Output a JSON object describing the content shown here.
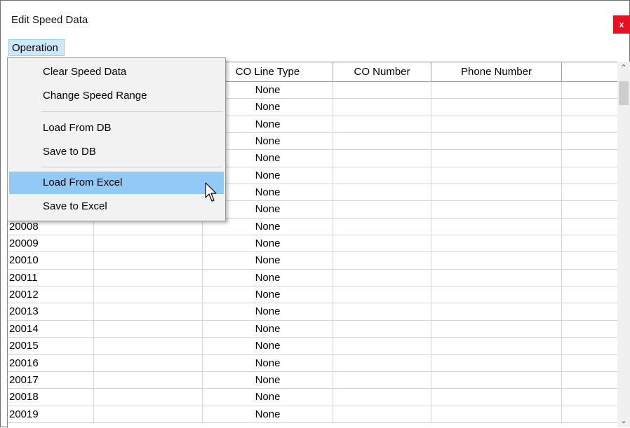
{
  "window": {
    "title": "Edit Speed Data",
    "close_label": "x"
  },
  "menubar": {
    "operation_label": "Operation"
  },
  "operation_menu": {
    "items": [
      {
        "label": "Clear Speed Data"
      },
      {
        "label": "Change Speed Range"
      },
      {
        "label": "Load From DB"
      },
      {
        "label": "Save to DB"
      },
      {
        "label": "Load From Excel",
        "highlighted": true
      },
      {
        "label": "Save to Excel"
      }
    ]
  },
  "table": {
    "columns": [
      "",
      "",
      "CO Line Type",
      "CO Number",
      "Phone Number",
      ""
    ],
    "rows": [
      {
        "id": "",
        "co_line_type": "None"
      },
      {
        "id": "",
        "co_line_type": "None"
      },
      {
        "id": "",
        "co_line_type": "None"
      },
      {
        "id": "",
        "co_line_type": "None"
      },
      {
        "id": "",
        "co_line_type": "None"
      },
      {
        "id": "",
        "co_line_type": "None"
      },
      {
        "id": "",
        "co_line_type": "None"
      },
      {
        "id": "",
        "co_line_type": "None"
      },
      {
        "id": "20008",
        "co_line_type": "None"
      },
      {
        "id": "20009",
        "co_line_type": "None"
      },
      {
        "id": "20010",
        "co_line_type": "None"
      },
      {
        "id": "20011",
        "co_line_type": "None"
      },
      {
        "id": "20012",
        "co_line_type": "None"
      },
      {
        "id": "20013",
        "co_line_type": "None"
      },
      {
        "id": "20014",
        "co_line_type": "None"
      },
      {
        "id": "20015",
        "co_line_type": "None"
      },
      {
        "id": "20016",
        "co_line_type": "None"
      },
      {
        "id": "20017",
        "co_line_type": "None"
      },
      {
        "id": "20018",
        "co_line_type": "None"
      },
      {
        "id": "20019",
        "co_line_type": "None"
      }
    ]
  },
  "colors": {
    "close_bg": "#e81123",
    "menu_highlight": "#91c9f7",
    "menubar_active": "#cde8fb"
  },
  "icons": {
    "close": "close-icon",
    "scroll_up": "chevron-up-icon",
    "scroll_down": "chevron-down-icon",
    "cursor": "mouse-pointer-icon"
  }
}
